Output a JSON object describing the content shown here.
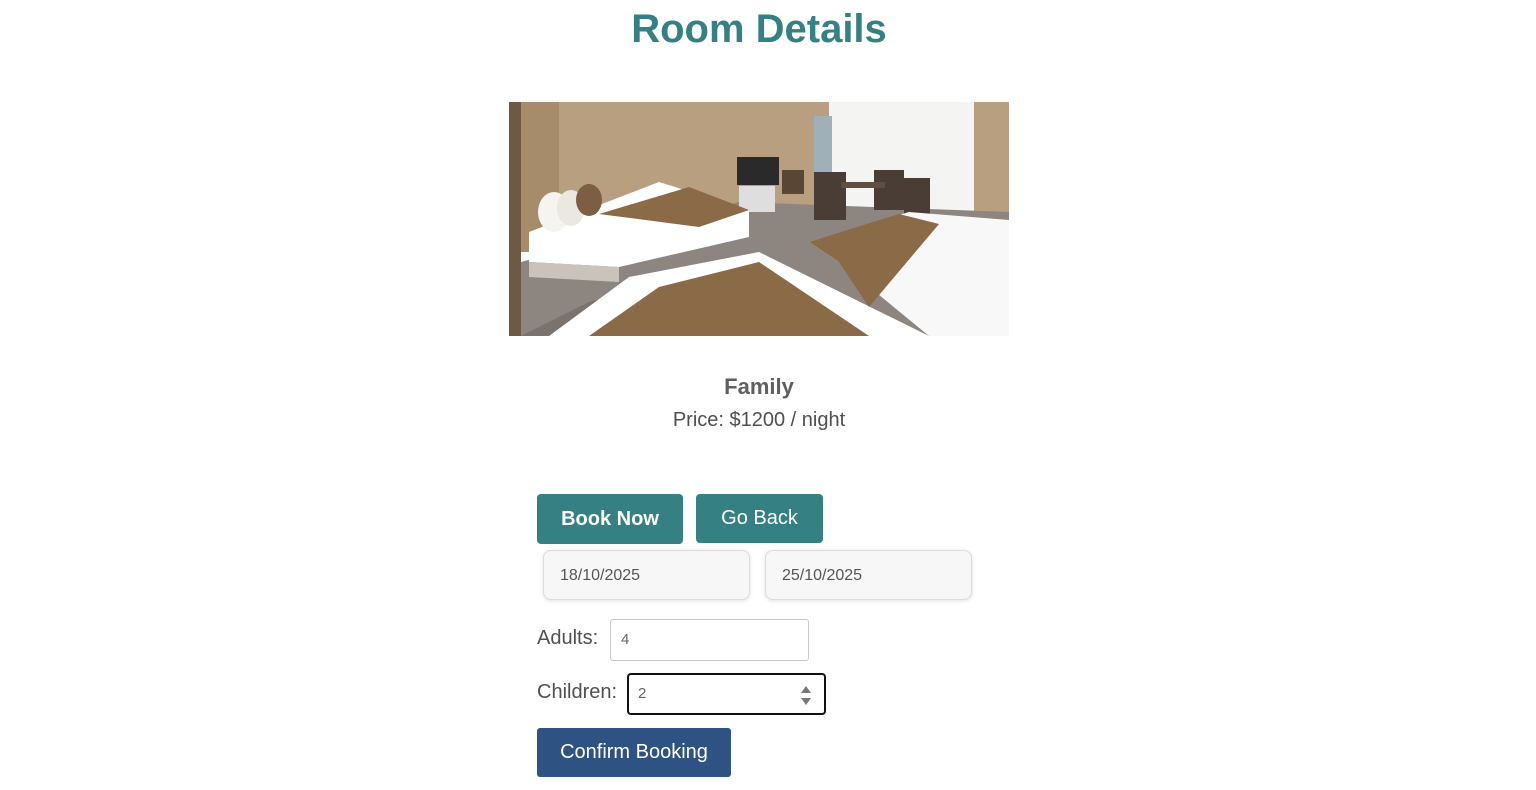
{
  "page": {
    "title": "Room Details"
  },
  "room": {
    "image_alt": "Hotel room with beds and seating area",
    "name": "Family",
    "price_text": "Price: $1200 / night"
  },
  "actions": {
    "book_now_label": "Book Now",
    "go_back_label": "Go Back",
    "confirm_label": "Confirm Booking"
  },
  "booking": {
    "check_in": "18/10/2025",
    "check_out": "25/10/2025",
    "adults_label": "Adults:",
    "adults_value": "4",
    "children_label": "Children:",
    "children_value": "2"
  },
  "colors": {
    "accent": "#358082",
    "confirm": "#2e5281",
    "text": "#4f4f4f"
  }
}
